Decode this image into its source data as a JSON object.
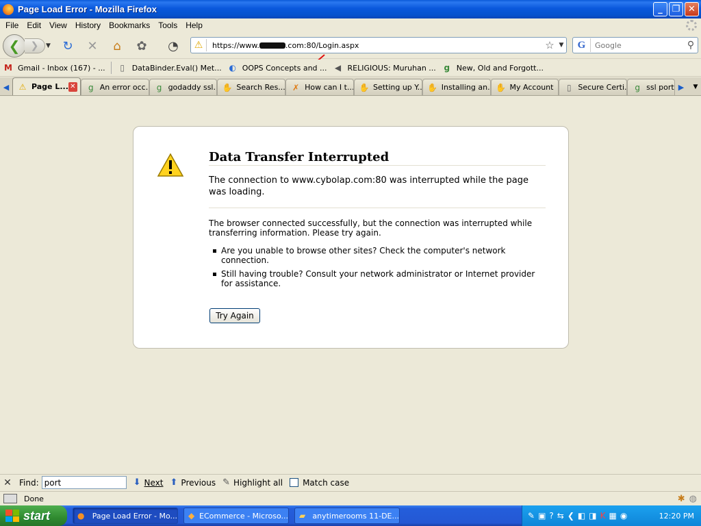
{
  "window": {
    "title": "Page Load Error - Mozilla Firefox",
    "min": "_",
    "max": "❐",
    "close": "✕"
  },
  "menubar": [
    "File",
    "Edit",
    "View",
    "History",
    "Bookmarks",
    "Tools",
    "Help"
  ],
  "navbar": {
    "url_prefix": "https://www.",
    "url_suffix": ".com:80/Login.aspx",
    "search_placeholder": "Google"
  },
  "bookmarks": [
    {
      "label": "Gmail - Inbox (167) - ...",
      "icon": "gmail-icon"
    },
    {
      "label": "DataBinder.Eval() Met...",
      "icon": "page-icon"
    },
    {
      "label": "OOPS Concepts and ...",
      "icon": "site-icon"
    },
    {
      "label": "RELIGIOUS: Muruhan ...",
      "icon": "speaker-icon"
    },
    {
      "label": "New, Old and Forgott...",
      "icon": "google-icon"
    }
  ],
  "tabs": [
    {
      "label": "Page L...",
      "active": true
    },
    {
      "label": "An error occ..."
    },
    {
      "label": "godaddy ssl..."
    },
    {
      "label": "Search Res..."
    },
    {
      "label": "How can I t..."
    },
    {
      "label": "Setting up Y..."
    },
    {
      "label": "Installing an..."
    },
    {
      "label": "My Account"
    },
    {
      "label": "Secure Certi..."
    },
    {
      "label": "ssl port -"
    }
  ],
  "error": {
    "title": "Data Transfer Interrupted",
    "short": "The connection to www.cybolap.com:80 was interrupted while the page was loading.",
    "long": "The browser connected successfully, but the connection was interrupted while transferring information. Please try again.",
    "items": [
      "Are you unable to browse other sites? Check the computer's network connection.",
      "Still having trouble? Consult your network administrator or Internet provider for assistance."
    ],
    "try_again": "Try Again"
  },
  "findbar": {
    "label": "Find:",
    "value": "port",
    "next": "Next",
    "previous": "Previous",
    "highlight": "Highlight all",
    "match_case": "Match case"
  },
  "status": {
    "text": "Done"
  },
  "taskbar": {
    "start": "start",
    "tasks": [
      {
        "label": "Page Load Error - Mo...",
        "active": true
      },
      {
        "label": "ECommerce - Microso..."
      },
      {
        "label": "anytimerooms 11-DE..."
      }
    ],
    "clock": "12:20 PM"
  },
  "colors": {
    "titlebar": "#0a58dc",
    "taskbar": "#245edb",
    "start": "#2f8a2f",
    "tab_close": "#d9453b",
    "annotation_arrow": "#e01010"
  }
}
